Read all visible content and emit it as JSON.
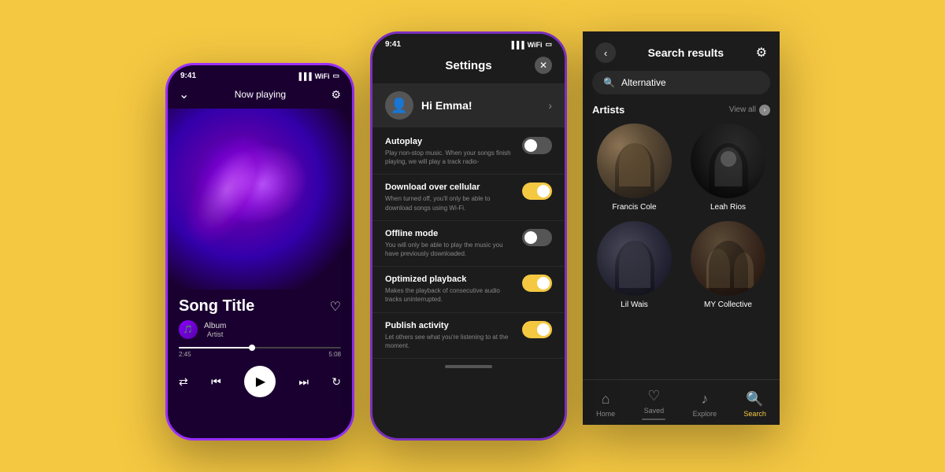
{
  "background": "#F5C842",
  "phone1": {
    "statusTime": "9:41",
    "topLabel": "Now playing",
    "songTitle": "Song Title",
    "albumName": "Album",
    "artistName": "Artist",
    "timeElapsed": "2:45",
    "timeTotal": "5:08"
  },
  "phone2": {
    "statusTime": "9:41",
    "title": "Settings",
    "greeting": "Hi Emma!",
    "items": [
      {
        "title": "Autoplay",
        "desc": "Play non-stop music. When your songs finish playing, we will play a track radio-",
        "state": "off"
      },
      {
        "title": "Download over cellular",
        "desc": "When turned off, you'll only be able to download songs using Wi-Fi.",
        "state": "on"
      },
      {
        "title": "Offline mode",
        "desc": "You will only be able to play the music you have previously downloaded.",
        "state": "off"
      },
      {
        "title": "Optimized playback",
        "desc": "Makes the playback of consecutive audio tracks uninterrupted.",
        "state": "on"
      },
      {
        "title": "Publish activity",
        "desc": "Let others see what you're listening to at the moment.",
        "state": "on"
      }
    ]
  },
  "phone3": {
    "title": "Search results",
    "searchQuery": "Alternative",
    "artistsLabel": "Artists",
    "viewAllLabel": "View all",
    "artists": [
      {
        "name": "Francis Cole"
      },
      {
        "name": "Leah Rios"
      },
      {
        "name": "Lil Wais"
      },
      {
        "name": "MY Collective"
      }
    ],
    "nav": [
      {
        "label": "Home",
        "icon": "🏠",
        "active": false
      },
      {
        "label": "Saved",
        "icon": "♡",
        "active": false
      },
      {
        "label": "Explore",
        "icon": "♪",
        "active": false
      },
      {
        "label": "Search",
        "icon": "🔍",
        "active": true
      }
    ]
  }
}
